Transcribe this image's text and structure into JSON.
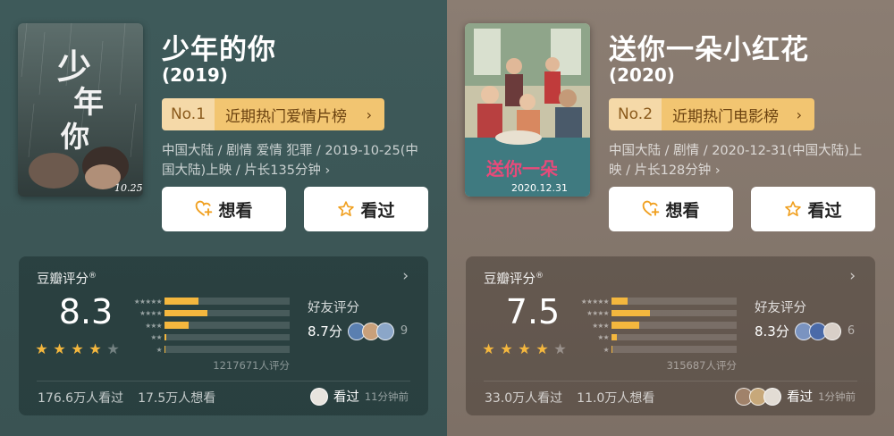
{
  "movies": [
    {
      "title": "少年的你",
      "year": "(2019)",
      "rank_no": "No.1",
      "rank_label": "近期热门爱情片榜",
      "rank_chevron": "›",
      "meta": "中国大陆 / 剧情 爱情 犯罪 / 2019-10-25(中国大陆)上映 / 片长135分钟 ›",
      "want_label": "想看",
      "seen_label": "看过",
      "rating_title": "豆瓣评分",
      "rating_mark": "®",
      "rating_chevron": "›",
      "score": "8.3",
      "stars": 4,
      "distribution": [
        0.27,
        0.34,
        0.19,
        0.015,
        0.01
      ],
      "rating_count": "1217671人评分",
      "friend_title": "好友评分",
      "friend_score": "8.7分",
      "friend_count": "9",
      "watched": "176.6万人看过",
      "want": "17.5万人想看",
      "activity_label": "看过",
      "activity_time": "11分钟前",
      "poster_date": "10.25",
      "colors": {
        "bg": "#3e5a5a"
      }
    },
    {
      "title": "送你一朵小红花",
      "year": "(2020)",
      "rank_no": "No.2",
      "rank_label": "近期热门电影榜",
      "rank_chevron": "›",
      "meta": "中国大陆 / 剧情 / 2020-12-31(中国大陆)上映 / 片长128分钟 ›",
      "want_label": "想看",
      "seen_label": "看过",
      "rating_title": "豆瓣评分",
      "rating_mark": "®",
      "rating_chevron": "›",
      "score": "7.5",
      "stars": 4,
      "distribution": [
        0.13,
        0.31,
        0.22,
        0.04,
        0.01
      ],
      "rating_count": "315687人评分",
      "friend_title": "好友评分",
      "friend_score": "8.3分",
      "friend_count": "6",
      "watched": "33.0万人看过",
      "want": "11.0万人想看",
      "activity_label": "看过",
      "activity_time": "1分钟前",
      "poster_date": "2020.12.31",
      "colors": {
        "bg": "#8b7d72"
      }
    }
  ],
  "star_glyph": "★",
  "colors": {
    "accent": "#f4b73e",
    "rank_bg": "#f2c571"
  },
  "icons": {
    "want": "heart-plus-icon",
    "seen": "star-outline-icon"
  }
}
